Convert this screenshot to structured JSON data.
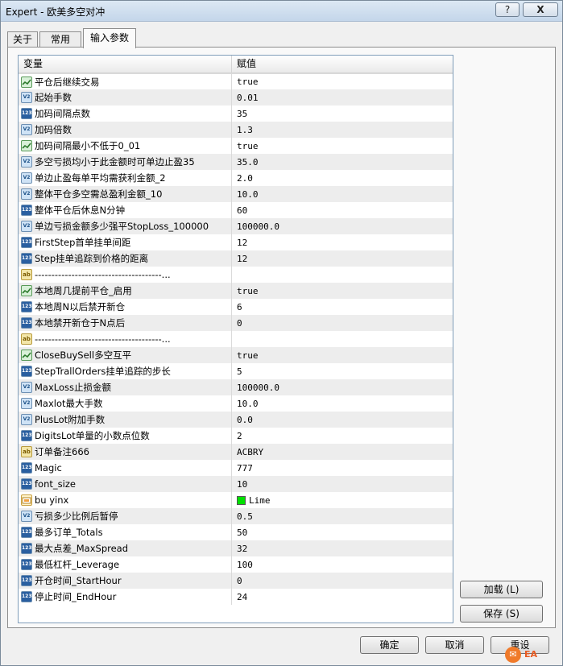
{
  "window": {
    "title": "Expert - 欧美多空对冲",
    "help_label": "?",
    "close_label": "X"
  },
  "tabs": [
    {
      "label": "关于"
    },
    {
      "label": "常用"
    },
    {
      "label": "输入参数"
    }
  ],
  "grid": {
    "col_variable": "变量",
    "col_value": "赋值",
    "rows": [
      {
        "icon": "bool-icon",
        "name": "平仓后继续交易",
        "value": "true"
      },
      {
        "icon": "double-icon",
        "name": "起始手数",
        "value": "0.01"
      },
      {
        "icon": "integer-icon",
        "name": "加码间隔点数",
        "value": "35"
      },
      {
        "icon": "double-icon",
        "name": "加码倍数",
        "value": "1.3"
      },
      {
        "icon": "bool-icon",
        "name": "加码间隔最小不低于0_01",
        "value": "true"
      },
      {
        "icon": "double-icon",
        "name": "多空亏损均小于此金额时可单边止盈35",
        "value": "35.0"
      },
      {
        "icon": "double-icon",
        "name": "单边止盈每单平均需获利金额_2",
        "value": "2.0"
      },
      {
        "icon": "double-icon",
        "name": "整体平仓多空需总盈利金额_10",
        "value": "10.0"
      },
      {
        "icon": "integer-icon",
        "name": "整体平仓后休息N分钟",
        "value": "60"
      },
      {
        "icon": "double-icon",
        "name": "单边亏损金额多少强平StopLoss_100000",
        "value": "100000.0"
      },
      {
        "icon": "integer-icon",
        "name": "FirstStep首单挂单间距",
        "value": "12"
      },
      {
        "icon": "integer-icon",
        "name": "Step挂单追踪到价格的距离",
        "value": "12"
      },
      {
        "icon": "string-icon",
        "name": "--------------------------------------...",
        "value": ""
      },
      {
        "icon": "bool-icon",
        "name": "本地周几提前平仓_启用",
        "value": "true"
      },
      {
        "icon": "integer-icon",
        "name": "本地周N以后禁开新仓",
        "value": "6"
      },
      {
        "icon": "integer-icon",
        "name": "本地禁开新仓于N点后",
        "value": "0"
      },
      {
        "icon": "string-icon",
        "name": "--------------------------------------...",
        "value": ""
      },
      {
        "icon": "bool-icon",
        "name": "CloseBuySell多空互平",
        "value": "true"
      },
      {
        "icon": "integer-icon",
        "name": "StepTrallOrders挂单追踪的步长",
        "value": "5"
      },
      {
        "icon": "double-icon",
        "name": "MaxLoss止损金额",
        "value": "100000.0"
      },
      {
        "icon": "double-icon",
        "name": "Maxlot最大手数",
        "value": "10.0"
      },
      {
        "icon": "double-icon",
        "name": "PlusLot附加手数",
        "value": "0.0"
      },
      {
        "icon": "integer-icon",
        "name": "DigitsLot单量的小数点位数",
        "value": "2"
      },
      {
        "icon": "string-icon",
        "name": "订单备注666",
        "value": "ACBRY"
      },
      {
        "icon": "integer-icon",
        "name": "Magic",
        "value": "777"
      },
      {
        "icon": "integer-icon",
        "name": "font_size",
        "value": "10"
      },
      {
        "icon": "color-icon",
        "name": "bu yinx",
        "value": "Lime",
        "swatch": "#00e000"
      },
      {
        "icon": "double-icon",
        "name": "亏损多少比例后暂停",
        "value": "0.5"
      },
      {
        "icon": "integer-icon",
        "name": "最多订单_Totals",
        "value": "50"
      },
      {
        "icon": "integer-icon",
        "name": "最大点差_MaxSpread",
        "value": "32"
      },
      {
        "icon": "integer-icon",
        "name": "最低杠杆_Leverage",
        "value": "100"
      },
      {
        "icon": "integer-icon",
        "name": "开仓时间_StartHour",
        "value": "0"
      },
      {
        "icon": "integer-icon",
        "name": "停止时间_EndHour",
        "value": "24"
      }
    ]
  },
  "side_buttons": {
    "load": "加载 (L)",
    "save": "保存 (S)"
  },
  "footer": {
    "ok": "确定",
    "cancel": "取消",
    "reset": "重设"
  },
  "watermark": {
    "logo_text": "EA"
  }
}
